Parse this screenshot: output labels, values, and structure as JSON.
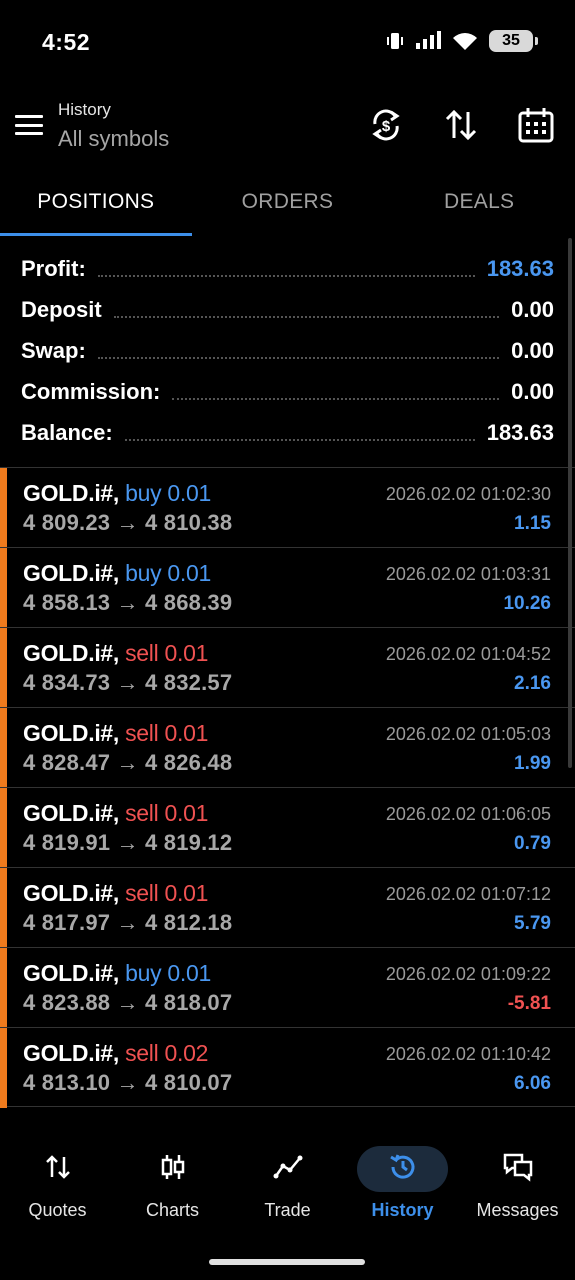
{
  "status_bar": {
    "time": "4:52",
    "battery": "35"
  },
  "header": {
    "title": "History",
    "subtitle": "All symbols"
  },
  "tabs": [
    {
      "label": "POSITIONS"
    },
    {
      "label": "ORDERS"
    },
    {
      "label": "DEALS"
    }
  ],
  "summary": {
    "profit": {
      "label": "Profit:",
      "value": "183.63"
    },
    "deposit": {
      "label": "Deposit",
      "value": "0.00"
    },
    "swap": {
      "label": "Swap:",
      "value": "0.00"
    },
    "commission": {
      "label": "Commission:",
      "value": "0.00"
    },
    "balance": {
      "label": "Balance:",
      "value": "183.63"
    }
  },
  "deals": [
    {
      "symbol": "GOLD.i#,",
      "side": "buy 0.01",
      "prices": "4 809.23 → 4 810.38",
      "datetime": "2026.02.02 01:02:30",
      "profit": "1.15"
    },
    {
      "symbol": "GOLD.i#,",
      "side": "buy 0.01",
      "prices": "4 858.13 → 4 868.39",
      "datetime": "2026.02.02 01:03:31",
      "profit": "10.26"
    },
    {
      "symbol": "GOLD.i#,",
      "side": "sell 0.01",
      "prices": "4 834.73 → 4 832.57",
      "datetime": "2026.02.02 01:04:52",
      "profit": "2.16"
    },
    {
      "symbol": "GOLD.i#,",
      "side": "sell 0.01",
      "prices": "4 828.47 → 4 826.48",
      "datetime": "2026.02.02 01:05:03",
      "profit": "1.99"
    },
    {
      "symbol": "GOLD.i#,",
      "side": "sell 0.01",
      "prices": "4 819.91 → 4 819.12",
      "datetime": "2026.02.02 01:06:05",
      "profit": "0.79"
    },
    {
      "symbol": "GOLD.i#,",
      "side": "sell 0.01",
      "prices": "4 817.97 → 4 812.18",
      "datetime": "2026.02.02 01:07:12",
      "profit": "5.79"
    },
    {
      "symbol": "GOLD.i#,",
      "side": "buy 0.01",
      "prices": "4 823.88 → 4 818.07",
      "datetime": "2026.02.02 01:09:22",
      "profit": "-5.81"
    },
    {
      "symbol": "GOLD.i#,",
      "side": "sell 0.02",
      "prices": "4 813.10 → 4 810.07",
      "datetime": "2026.02.02 01:10:42",
      "profit": "6.06"
    }
  ],
  "nav": [
    {
      "label": "Quotes",
      "icon": "quotes-arrows-icon"
    },
    {
      "label": "Charts",
      "icon": "candlestick-icon"
    },
    {
      "label": "Trade",
      "icon": "trend-line-icon"
    },
    {
      "label": "History",
      "icon": "history-clock-icon"
    },
    {
      "label": "Messages",
      "icon": "chat-bubbles-icon"
    }
  ],
  "colors": {
    "accent": "#3d8fea",
    "buy": "#4a97f0",
    "sell": "#f05252",
    "position_bar": "#f07b1d"
  }
}
